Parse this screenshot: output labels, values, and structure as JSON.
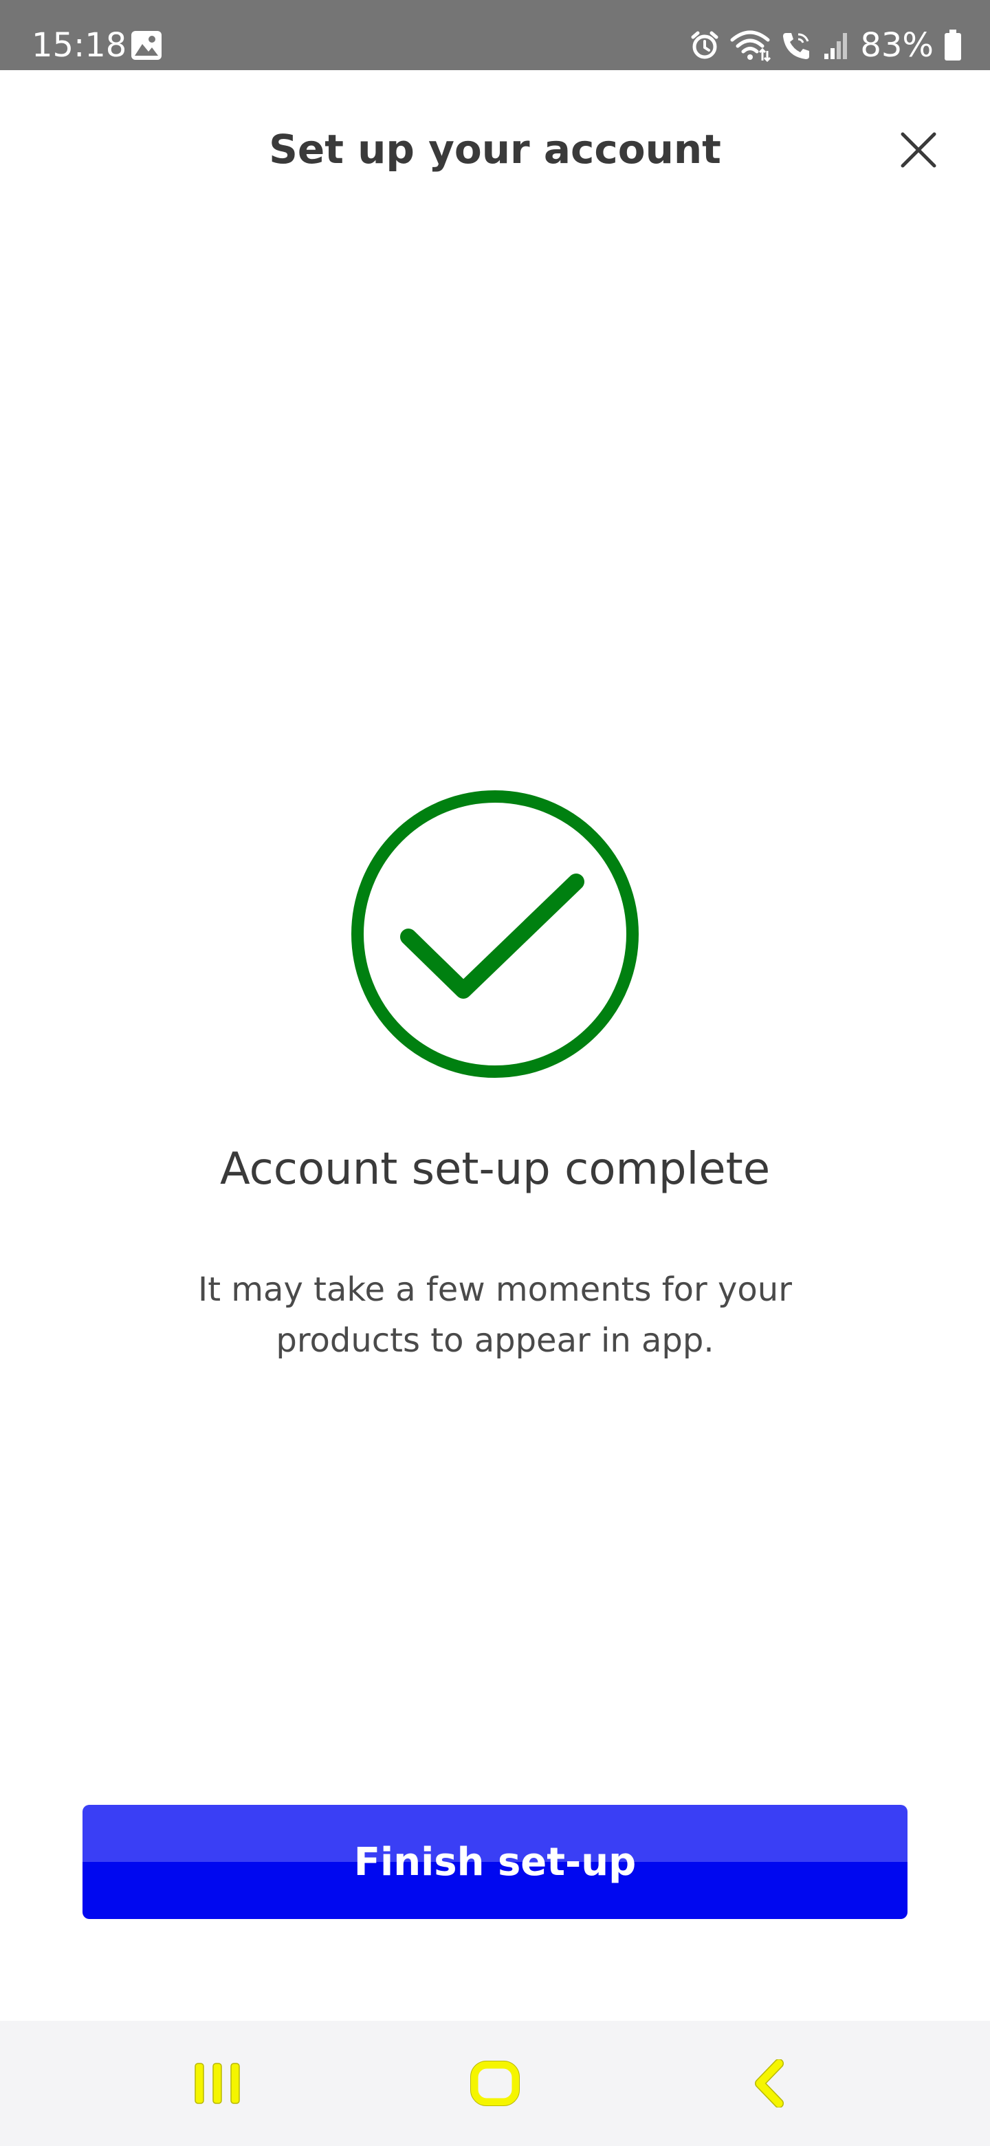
{
  "status_bar": {
    "time": "15:18",
    "battery": "83%",
    "icons": [
      "gallery-icon",
      "alarm-icon",
      "wifi-icon",
      "wifi-calling-icon",
      "signal-icon",
      "battery-icon"
    ]
  },
  "header": {
    "title": "Set up your account",
    "close_icon": "close-icon"
  },
  "success": {
    "icon": "check-circle-icon",
    "title": "Account set-up complete",
    "message": "It may take a few moments for your products to appear in app."
  },
  "actions": {
    "finish_label": "Finish set-up"
  },
  "nav_bar": {
    "icons": [
      "recents-icon",
      "home-icon",
      "back-icon"
    ]
  },
  "colors": {
    "success_green": "#008010",
    "button_blue": "#0008f0",
    "button_blue_light": "#3a3ff5",
    "nav_icon_yellow": "#f5f500",
    "status_bar_gray": "#757575"
  }
}
